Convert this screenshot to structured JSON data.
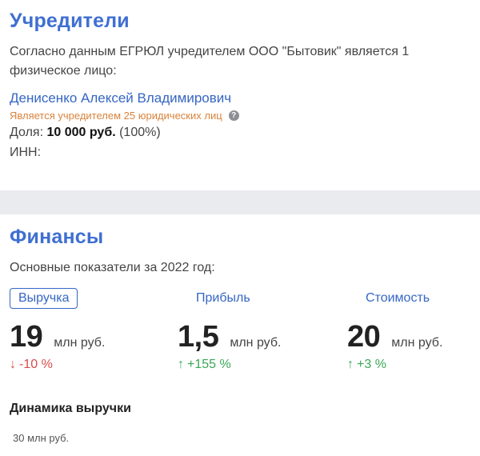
{
  "founders": {
    "title": "Учредители",
    "description": "Согласно данным ЕГРЮЛ учредителем ООО \"Бытовик\" является 1 физическое лицо:",
    "person_name": "Денисенко Алексей Владимирович",
    "person_note": "Является учредителем 25 юридических лиц",
    "share_label": "Доля:",
    "share_value": "10 000 руб.",
    "share_percent": "(100%)",
    "inn_label": "ИНН:",
    "help_icon": "?"
  },
  "finances": {
    "title": "Финансы",
    "intro": "Основные показатели за 2022 год:",
    "metrics": [
      {
        "tab": "Выручка",
        "value": "19",
        "unit": "млн руб.",
        "arrow": "↓",
        "delta": "-10 %",
        "direction": "down",
        "active": true
      },
      {
        "tab": "Прибыль",
        "value": "1,5",
        "unit": "млн руб.",
        "arrow": "↑",
        "delta": "+155 %",
        "direction": "up",
        "active": false
      },
      {
        "tab": "Стоимость",
        "value": "20",
        "unit": "млн руб.",
        "arrow": "↑",
        "delta": "+3 %",
        "direction": "up",
        "active": false
      }
    ],
    "dynamics_title": "Динамика выручки",
    "axis_label": "30 млн руб."
  },
  "colors": {
    "accent": "#3f6fd1",
    "link": "#3566c4",
    "note": "#d9833c",
    "down": "#d94b4b",
    "up": "#3aa757"
  }
}
